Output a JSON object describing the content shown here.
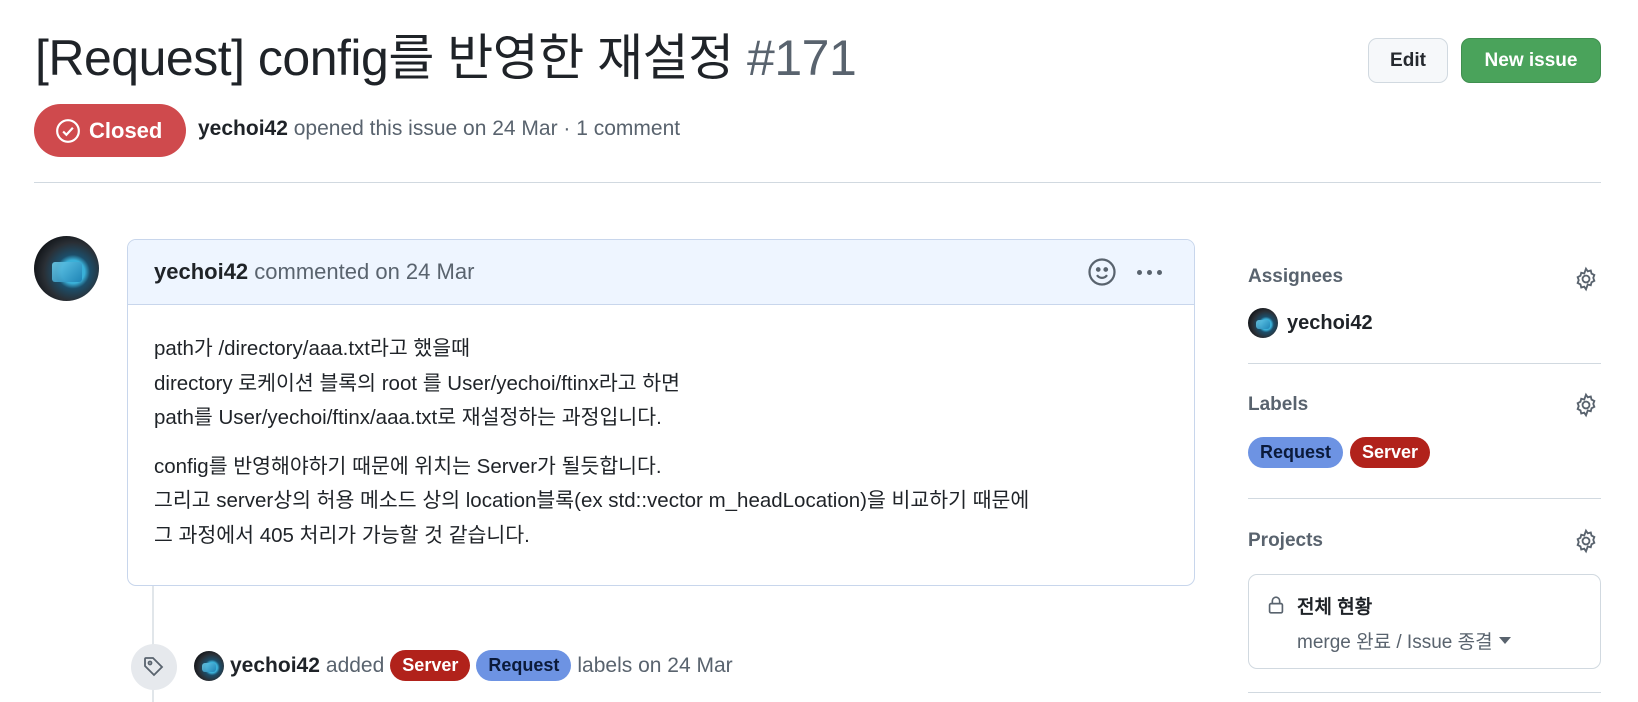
{
  "issue": {
    "title": "[Request] config를 반영한 재설정",
    "number": "#171",
    "state": "Closed",
    "author": "yechoi42",
    "meta_text": "opened this issue on 24 Mar · 1 comment"
  },
  "header": {
    "edit_label": "Edit",
    "new_issue_label": "New issue"
  },
  "comment": {
    "author": "yechoi42",
    "action": "commented on 24 Mar",
    "paragraphs": [
      [
        "path가 /directory/aaa.txt라고 했을때",
        "directory 로케이션 블록의 root 를 User/yechoi/ftinx라고 하면",
        "path를 User/yechoi/ftinx/aaa.txt로 재설정하는 과정입니다."
      ],
      [
        "config를 반영해야하기 때문에 위치는 Server가 될듯합니다.",
        "그리고 server상의 허용 메소드 상의 location블록(ex std::vector m_headLocation)을 비교하기 때문에",
        "그 과정에서 405 처리가 가능할 것 같습니다."
      ]
    ]
  },
  "event": {
    "actor": "yechoi42",
    "verb": "added",
    "labels": [
      "Server",
      "Request"
    ],
    "suffix": "labels on 24 Mar"
  },
  "sidebar": {
    "assignees_heading": "Assignees",
    "assignee": "yechoi42",
    "labels_heading": "Labels",
    "labels": [
      "Request",
      "Server"
    ],
    "projects_heading": "Projects",
    "project_name": "전체 현황",
    "project_status": "merge 완료 / Issue 종결"
  },
  "colors": {
    "closed": "#cf4a4d",
    "new_issue": "#4aa35b",
    "label_server": "#b1221b",
    "label_request": "#6d93e3"
  },
  "icons": [
    "check-circle-icon",
    "smiley-icon",
    "kebab-icon",
    "gear-icon",
    "tag-icon",
    "lock-icon",
    "caret-down-icon"
  ]
}
